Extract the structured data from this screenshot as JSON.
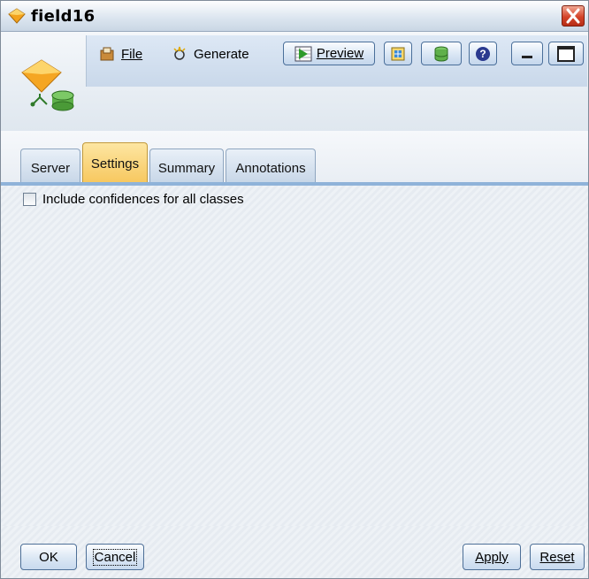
{
  "window": {
    "title": "field16"
  },
  "toolbar": {
    "file_label": "File",
    "generate_label": "Generate",
    "preview_label": "Preview"
  },
  "tabs": [
    {
      "label": "Server"
    },
    {
      "label": "Settings"
    },
    {
      "label": "Summary"
    },
    {
      "label": "Annotations"
    }
  ],
  "settings": {
    "include_confidences_label": "Include confidences for all classes",
    "include_confidences_checked": false
  },
  "footer": {
    "ok_label": "OK",
    "cancel_label": "Cancel",
    "apply_label": "Apply",
    "reset_label": "Reset"
  },
  "colors": {
    "active_tab": "#f7c860",
    "close_button": "#d4442a",
    "accent": "#4a6f9a"
  },
  "icons": [
    "diamond-icon",
    "close-icon",
    "model-node-icon",
    "file-icon",
    "generate-icon",
    "preview-icon",
    "export-icon",
    "database-icon",
    "help-icon",
    "minimize-icon",
    "maximize-icon"
  ]
}
